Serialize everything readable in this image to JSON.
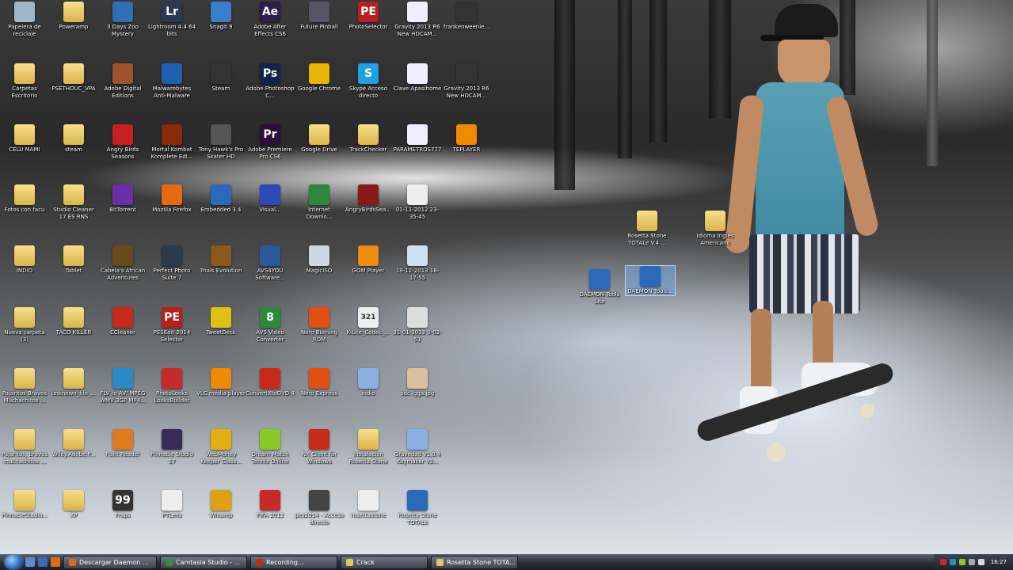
{
  "desktop_icons": [
    {
      "label": "Papelera de reciclaje",
      "icon": "recycle-bin-icon",
      "color": "#9fb6c9"
    },
    {
      "label": "Poweramp",
      "icon": "folder-icon",
      "color": "folder"
    },
    {
      "label": "3 Days Zoo Mystery",
      "icon": "game-icon",
      "color": "#2f6fb2"
    },
    {
      "label": "Lightroom 4.4 64 bits",
      "icon": "lightroom-icon",
      "color": "#2a3a52",
      "glyph": "Lr"
    },
    {
      "label": "Snagit 9",
      "icon": "snagit-icon",
      "color": "#3a80c8"
    },
    {
      "label": "Adobe After Effects CS6",
      "icon": "after-effects-icon",
      "color": "#2b1e4a",
      "glyph": "Ae"
    },
    {
      "label": "Future Pinball",
      "icon": "pinball-icon",
      "color": "#556"
    },
    {
      "label": "PhotoSelector",
      "icon": "pe-icon",
      "color": "#b81f1f",
      "glyph": "PE"
    },
    {
      "label": "Gravity 2013 R6 New HDCAM...",
      "icon": "file-icon",
      "color": "#eef"
    },
    {
      "label": "frankenweenie...",
      "icon": "video-icon",
      "color": "#333"
    },
    {
      "label": "Carpetas Escritorio",
      "icon": "folder-icon",
      "color": "folder"
    },
    {
      "label": "PSETHOUC_VPA",
      "icon": "folder-icon",
      "color": "folder"
    },
    {
      "label": "Adobe Digital Editions",
      "icon": "book-icon",
      "color": "#a0522d"
    },
    {
      "label": "Malwarebytes Anti-Malware",
      "icon": "shield-icon",
      "color": "#1d5fb0"
    },
    {
      "label": "Steam",
      "icon": "steam-icon",
      "color": "#333"
    },
    {
      "label": "Adobe Photoshop C...",
      "icon": "photoshop-icon",
      "color": "#12244a",
      "glyph": "Ps"
    },
    {
      "label": "Google Chrome",
      "icon": "chrome-icon",
      "color": "#e8b400"
    },
    {
      "label": "Skype Acceso directo",
      "icon": "skype-icon",
      "color": "#1fa0e0",
      "glyph": "S"
    },
    {
      "label": "Clave Apasihome",
      "icon": "file-icon",
      "color": "#eef"
    },
    {
      "label": "Gravity 2013 R6 New HDCAM...",
      "icon": "video-icon",
      "color": "#333"
    },
    {
      "label": "CELU MAMI",
      "icon": "folder-icon",
      "color": "folder"
    },
    {
      "label": "steam",
      "icon": "folder-icon",
      "color": "folder"
    },
    {
      "label": "Angry Birds Seasons",
      "icon": "angry-birds-icon",
      "color": "#c82020"
    },
    {
      "label": "Mortal Kombat Komplete Edi...",
      "icon": "mk-icon",
      "color": "#8a2a0a"
    },
    {
      "label": "Tony Hawk's Pro Skater HD",
      "icon": "skate-icon",
      "color": "#555"
    },
    {
      "label": "Adobe Premiere Pro CS6",
      "icon": "premiere-icon",
      "color": "#2a0f3a",
      "glyph": "Pr"
    },
    {
      "label": "Google Drive",
      "icon": "drive-icon",
      "color": "folder"
    },
    {
      "label": "TrackChecker",
      "icon": "folder-icon",
      "color": "folder"
    },
    {
      "label": "PARAMETROS777",
      "icon": "file-icon",
      "color": "#eef"
    },
    {
      "label": "TEPLAYER",
      "icon": "vlc-icon",
      "color": "#f08a00"
    },
    {
      "label": "Fotos con facu",
      "icon": "folder-icon",
      "color": "folder"
    },
    {
      "label": "Studio Cleaner 17 ES RNS",
      "icon": "folder-icon",
      "color": "folder"
    },
    {
      "label": "BitTorrent",
      "icon": "bittorrent-icon",
      "color": "#6a2fa8"
    },
    {
      "label": "Mozilla Firefox",
      "icon": "firefox-icon",
      "color": "#e56a12"
    },
    {
      "label": "Embedded 3.4",
      "icon": "app-icon",
      "color": "#2a6ab8"
    },
    {
      "label": "Visual...",
      "icon": "app-icon",
      "color": "#2a4ab8"
    },
    {
      "label": "Internet Downlo...",
      "icon": "idm-icon",
      "color": "#2a8a3a"
    },
    {
      "label": "AngryBirdsSea...",
      "icon": "angry-birds-icon",
      "color": "#8a1a1a"
    },
    {
      "label": "01-11-2012 23-35-45",
      "icon": "image-icon",
      "color": "#eee"
    },
    {
      "label": "INDIO",
      "icon": "folder-icon",
      "color": "folder"
    },
    {
      "label": "Tablet",
      "icon": "folder-icon",
      "color": "folder"
    },
    {
      "label": "Cabela's African Adventures",
      "icon": "game-icon",
      "color": "#6a4a1a"
    },
    {
      "label": "Perfect Photo Suite 7",
      "icon": "camera-icon",
      "color": "#2a3a4a"
    },
    {
      "label": "Trials Evolution",
      "icon": "game-icon",
      "color": "#8a5a1a"
    },
    {
      "label": "AVS4YOU Software...",
      "icon": "avs-icon",
      "color": "#2a5a9a"
    },
    {
      "label": "MagicISO",
      "icon": "disc-icon",
      "color": "#cfd6e0"
    },
    {
      "label": "GOM Player",
      "icon": "gom-icon",
      "color": "#f08a10"
    },
    {
      "label": "19-12-2013 18-17-55",
      "icon": "image-icon",
      "color": "#cfe0f0"
    },
    {
      "label": "Nueva carpeta (3)",
      "icon": "folder-icon",
      "color": "folder"
    },
    {
      "label": "TACO KILLER",
      "icon": "folder-icon",
      "color": "folder"
    },
    {
      "label": "CCleaner",
      "icon": "ccleaner-icon",
      "color": "#c82a1a"
    },
    {
      "label": "PESEdit 2014 Selector",
      "icon": "pe-icon",
      "color": "#b81f1f",
      "glyph": "PE"
    },
    {
      "label": "TweetDeck",
      "icon": "tweetdeck-icon",
      "color": "#e0c010"
    },
    {
      "label": "AVS Video Converter",
      "icon": "avs-icon",
      "color": "#2a8a3a",
      "glyph": "8"
    },
    {
      "label": "Nero Burning ROM",
      "icon": "nero-icon",
      "color": "#e05010"
    },
    {
      "label": "K-Lite_Codec_...",
      "icon": "klite-icon",
      "color": "#eee",
      "glyph": "321"
    },
    {
      "label": "31-01-2013 0-02-51",
      "icon": "image-icon",
      "color": "#ddd"
    },
    {
      "label": "Pajaritos Bravos Muchachitos ...",
      "icon": "folder-icon",
      "color": "folder"
    },
    {
      "label": "unknown_file_...",
      "icon": "folder-icon",
      "color": "folder"
    },
    {
      "label": "FLV to AVI MPEG WMV 3GP MP4...",
      "icon": "converter-icon",
      "color": "#2a8ac8"
    },
    {
      "label": "PhotoLooks LooksBuilder",
      "icon": "photolooks-icon",
      "color": "#c82a2a"
    },
    {
      "label": "VLC media player",
      "icon": "vlc-icon",
      "color": "#f08a00"
    },
    {
      "label": "ConvertXtoDVD 4",
      "icon": "convertx-icon",
      "color": "#c82a1a"
    },
    {
      "label": "Nero Express",
      "icon": "nero-icon",
      "color": "#e05010"
    },
    {
      "label": "indio",
      "icon": "doc-icon",
      "color": "#8ab0e0"
    },
    {
      "label": "sdc lgga.jpg",
      "icon": "image-icon",
      "color": "#d9c0a0"
    },
    {
      "label": "Pajaritos, bravos muchachitos ...",
      "icon": "folder-icon",
      "color": "folder"
    },
    {
      "label": "Wiley.Adobe.P...",
      "icon": "folder-icon",
      "color": "folder"
    },
    {
      "label": "Foxit Reader",
      "icon": "foxit-icon",
      "color": "#e07a20"
    },
    {
      "label": "Pinnacle Studio 17",
      "icon": "pinnacle-icon",
      "color": "#3a2a5a"
    },
    {
      "label": "WebMoney Keeper Class...",
      "icon": "webmoney-icon",
      "color": "#e0b010"
    },
    {
      "label": "Dream Match Tennis Online",
      "icon": "tennis-icon",
      "color": "#8ac82a"
    },
    {
      "label": "NX Client for Windows",
      "icon": "nx-icon",
      "color": "#c82a1a"
    },
    {
      "label": "Instalacion Rosetta Stone",
      "icon": "folder-icon",
      "color": "folder"
    },
    {
      "label": "Gravedad v1.0.4 Keymaker v3...",
      "icon": "doc-icon",
      "color": "#8ab0e0"
    },
    {
      "label": "PinnacleStudio...",
      "icon": "folder-icon",
      "color": "folder"
    },
    {
      "label": "XP",
      "icon": "folder-icon",
      "color": "folder"
    },
    {
      "label": "Fraps",
      "icon": "fraps-icon",
      "color": "#333",
      "glyph": "99"
    },
    {
      "label": "PTLens",
      "icon": "ptlens-icon",
      "color": "#eee"
    },
    {
      "label": "Winamp",
      "icon": "winamp-icon",
      "color": "#e0a010"
    },
    {
      "label": "FIFA 2012",
      "icon": "fifa-icon",
      "color": "#c82a2a"
    },
    {
      "label": "pes2014 - Acceso directo",
      "icon": "pes-icon",
      "color": "#444"
    },
    {
      "label": "rosettastone",
      "icon": "file-icon",
      "color": "#eee"
    },
    {
      "label": "Rosetta Stone TOTALe",
      "icon": "rosetta-icon",
      "color": "#2a6ab8"
    },
    {
      "label": "Rosetta Stone TOTALe V.4 ...",
      "icon": "folder-icon",
      "color": "folder"
    },
    {
      "label": "Idioma Ingles Americano",
      "icon": "folder-icon",
      "color": "folder"
    },
    {
      "label": "DAEMON Tools Lite",
      "icon": "daemon-icon",
      "color": "#2a6ab8"
    },
    {
      "label": "DAEMON Tools...",
      "icon": "daemon-icon",
      "color": "#2a6ab8"
    }
  ],
  "taskbar": {
    "tasks": [
      {
        "label": "Descargar Daemon ...",
        "icon": "firefox-icon",
        "color": "#e56a12"
      },
      {
        "label": "Camtasia Studio - ...",
        "icon": "camtasia-icon",
        "color": "#3a8a3a"
      },
      {
        "label": "Recording...",
        "icon": "record-icon",
        "color": "#c82a1a"
      },
      {
        "label": "Crack",
        "icon": "folder-icon",
        "color": "#e8c45a"
      },
      {
        "label": "Rosetta Stone TOTA...",
        "icon": "folder-icon",
        "color": "#e8c45a"
      }
    ],
    "clock": "16:27"
  }
}
